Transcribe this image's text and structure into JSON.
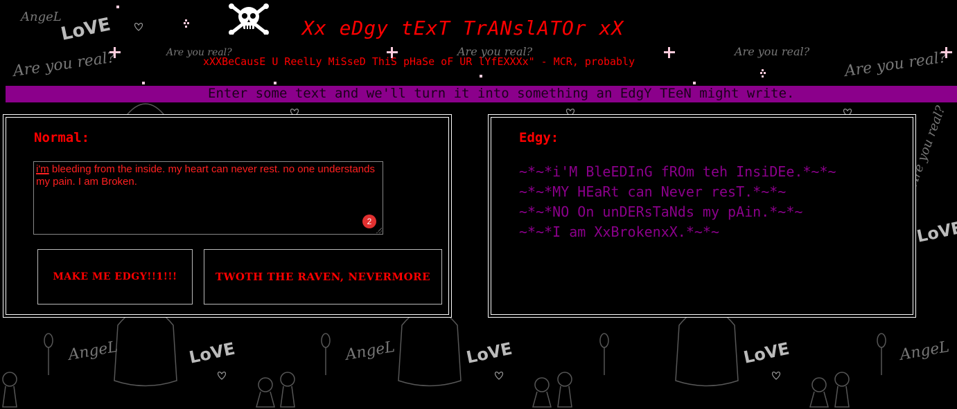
{
  "header": {
    "title": "Xx eDgy tExT TrANslATOr xX",
    "subtitle": "xXXBeCausE U ReelLy MiSseD ThiS pHaSe oF UR lYfEXXXx\" - MCR, probably",
    "banner": "Enter some text and we'll turn it into something an EdgY TEeN might write."
  },
  "normal_panel": {
    "heading": "Normal:",
    "input": {
      "misspelled_word": "i'm",
      "text_rest": " bleeding from the inside. my heart can never rest. no one understands my pain. I am Broken.",
      "error_count": "2"
    },
    "buttons": {
      "edgy_label": "MAKE ME EDGY!!1!!!",
      "raven_label": "TWOTH THE RAVEN, NEVERMORE"
    }
  },
  "edgy_panel": {
    "heading": "Edgy:",
    "output_lines": [
      "~*~*i'M BleEDInG fROm teh InsiDEe.*~*~",
      "~*~*MY HEaRt can Never resT.*~*~",
      "~*~*NO On unDERsTaNds my pAin.*~*~",
      "~*~*I am XxBrokenxX.*~*~"
    ]
  },
  "background": {
    "doodle_words": [
      "Angel",
      "LoVE",
      "Are you real?"
    ]
  },
  "colors": {
    "background": "#000000",
    "accent_red": "#ff0000",
    "banner_purple": "#8b008b",
    "output_purple": "#8b008b",
    "border": "#ffffff",
    "badge": "#e23030"
  }
}
